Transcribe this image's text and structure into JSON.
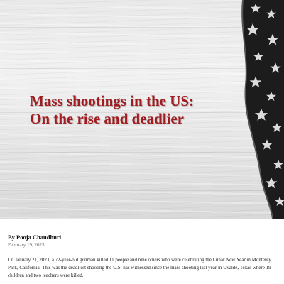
{
  "article": {
    "headline_line1": "Mass shootings in the US:",
    "headline_line2": "On the rise and deadlier",
    "byline": "By Pooja Chaudhuri",
    "date": "February 19, 2023",
    "body": "On January 21, 2023, a 72-year-old gunman killed 11 people and nine others who were celebrating the Lunar New Year in Monterey Park, California. This was the deadliest shooting the U.S. has witnessed since the mass shooting last year in Uvalde, Texas where 19 children and two teachers were killed."
  },
  "colors": {
    "headline": "#a01c20",
    "flag_dark": "#1c1c1c",
    "flag_light": "#dcdcdc"
  },
  "hero_image": {
    "background": "white-wood-planks",
    "accent": "us-flag-stars-icon"
  }
}
